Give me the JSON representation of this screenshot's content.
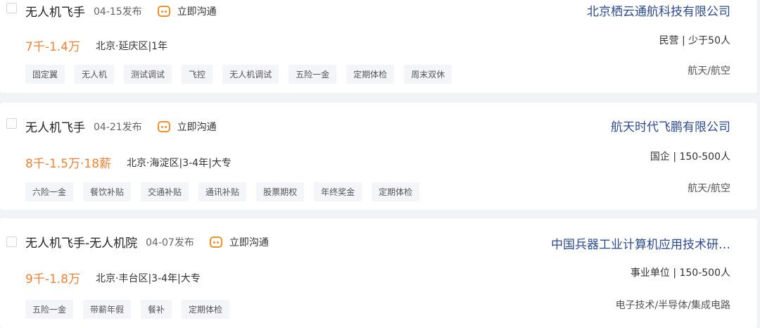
{
  "jobs": [
    {
      "title": "无人机飞手",
      "date": "04-15发布",
      "chat_label": "立即沟通",
      "salary": "7千-1.4万",
      "meta": "北京·延庆区|1年",
      "tags": [
        "固定翼",
        "无人机",
        "测试调试",
        "飞控",
        "无人机调试",
        "五险一金",
        "定期体检",
        "周末双休"
      ],
      "company": "北京栖云通航科技有限公司",
      "company_meta": "民营 | 少于50人",
      "industry": "航天/航空"
    },
    {
      "title": "无人机飞手",
      "date": "04-21发布",
      "chat_label": "立即沟通",
      "salary": "8千-1.5万·18薪",
      "meta": "北京·海淀区|3-4年|大专",
      "tags": [
        "六险一金",
        "餐饮补贴",
        "交通补贴",
        "通讯补贴",
        "股票期权",
        "年终奖金",
        "定期体检"
      ],
      "company": "航天时代飞鹏有限公司",
      "company_meta": "国企 | 150-500人",
      "industry": "航天/航空"
    },
    {
      "title": "无人机飞手-无人机院",
      "date": "04-07发布",
      "chat_label": "立即沟通",
      "salary": "9千-1.8万",
      "meta": "北京·丰台区|3-4年|大专",
      "tags": [
        "五险一金",
        "带薪年假",
        "餐补",
        "定期体检"
      ],
      "company": "中国兵器工业计算机应用技术研…",
      "company_meta": "事业单位 | 150-500人",
      "industry": "电子技术/半导体/集成电路"
    }
  ]
}
